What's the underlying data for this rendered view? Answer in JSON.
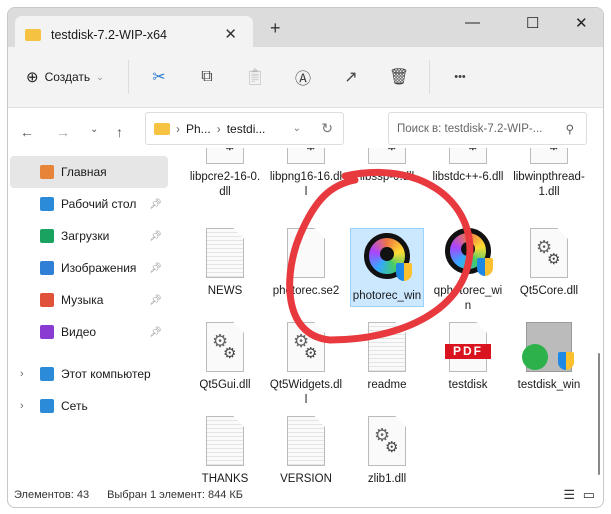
{
  "window": {
    "tab_title": "testdisk-7.2-WIP-x64",
    "minimize": "—",
    "maximize": "☐",
    "close": "✕",
    "new_tab": "+",
    "tab_close": "✕"
  },
  "toolbar": {
    "create_label": "Создать",
    "more": "•••"
  },
  "address": {
    "crumbs": [
      "Ph...",
      "testdi..."
    ],
    "search_placeholder": "Поиск в: testdisk-7.2-WIP-..."
  },
  "sidebar": {
    "items": [
      {
        "label": "Главная",
        "color": "#e8833a"
      },
      {
        "label": "Рабочий стол",
        "color": "#2b8bd8"
      },
      {
        "label": "Загрузки",
        "color": "#1aa260"
      },
      {
        "label": "Изображения",
        "color": "#2f7fd6"
      },
      {
        "label": "Музыка",
        "color": "#e0533a"
      },
      {
        "label": "Видео",
        "color": "#8a3bd1"
      },
      {
        "label": "Этот компьютер",
        "color": "#2b8bd8"
      },
      {
        "label": "Сеть",
        "color": "#2b8bd8"
      }
    ]
  },
  "files": [
    {
      "name": "libpcre2-16-0.dll",
      "type": "dll"
    },
    {
      "name": "libpng16-16.dll",
      "type": "dll"
    },
    {
      "name": "libssp-0.dll",
      "type": "dll"
    },
    {
      "name": "libstdc++-6.dll",
      "type": "dll"
    },
    {
      "name": "libwinpthread-1.dll",
      "type": "dll"
    },
    {
      "name": "NEWS",
      "type": "txt"
    },
    {
      "name": "photorec.se2",
      "type": "blank"
    },
    {
      "name": "photorec_win",
      "type": "exe"
    },
    {
      "name": "qphotorec_win",
      "type": "exe"
    },
    {
      "name": "Qt5Core.dll",
      "type": "dll"
    },
    {
      "name": "Qt5Gui.dll",
      "type": "dll"
    },
    {
      "name": "Qt5Widgets.dll",
      "type": "dll"
    },
    {
      "name": "readme",
      "type": "txt"
    },
    {
      "name": "testdisk",
      "type": "pdf"
    },
    {
      "name": "testdisk_win",
      "type": "exe2"
    },
    {
      "name": "THANKS",
      "type": "txt"
    },
    {
      "name": "VERSION",
      "type": "txt"
    },
    {
      "name": "zlib1.dll",
      "type": "dll"
    }
  ],
  "pdf_label": "PDF",
  "status": {
    "count": "Элементов: 43",
    "selection": "Выбран 1 элемент: 844 КБ"
  }
}
